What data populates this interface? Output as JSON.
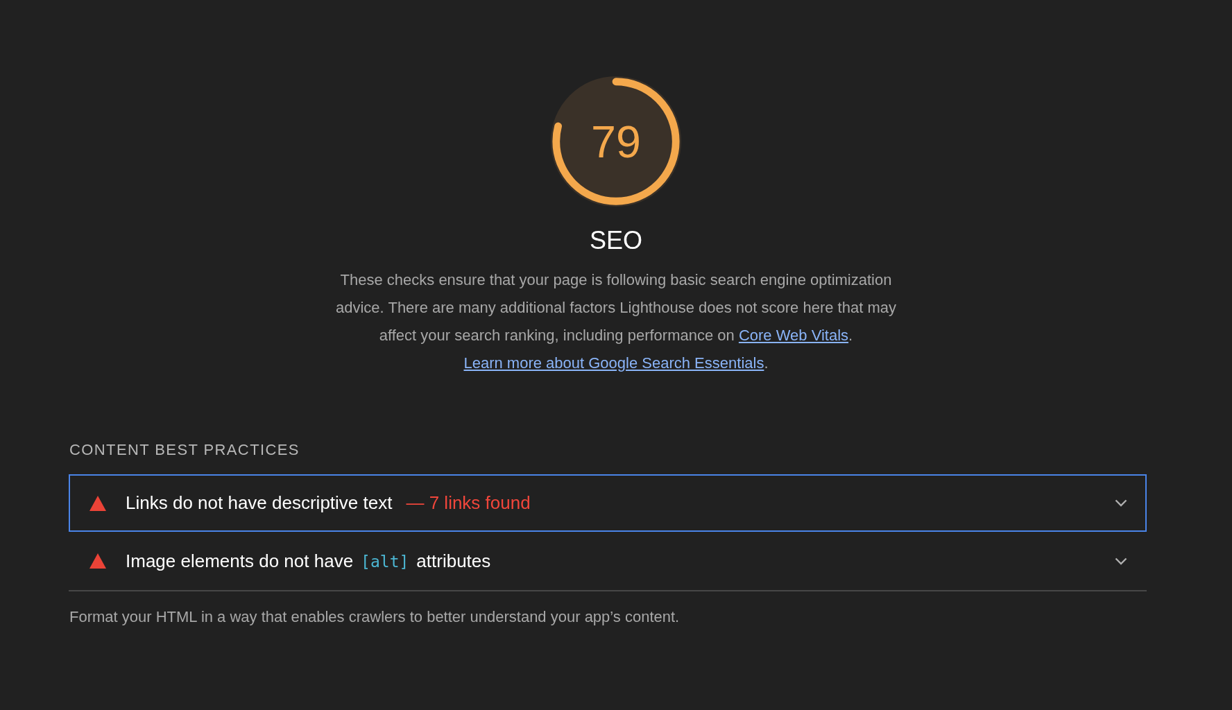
{
  "gauge": {
    "score": "79",
    "level": 0.79,
    "title": "SEO"
  },
  "description": {
    "text": "These checks ensure that your page is following basic search engine optimization advice. There are many additional factors Lighthouse does not score here that may affect your search ranking, including performance on ",
    "links": [
      {
        "text": "Core Web Vitals",
        "after": ". "
      },
      {
        "text": "Learn more about Google Search Essentials",
        "after": "."
      }
    ]
  },
  "group": {
    "title": "CONTENT BEST PRACTICES",
    "audits": [
      {
        "selected": true,
        "parts": [
          {
            "kind": "text",
            "text": "Links do not have descriptive text"
          }
        ],
        "display_value": "— 7 links found"
      },
      {
        "selected": false,
        "parts": [
          {
            "kind": "text",
            "text": "Image elements do not have"
          },
          {
            "kind": "code",
            "text": "[alt]"
          },
          {
            "kind": "text",
            "text": "attributes"
          }
        ]
      }
    ],
    "footer": "Format your HTML in a way that enables crawlers to better understand your app’s content."
  }
}
